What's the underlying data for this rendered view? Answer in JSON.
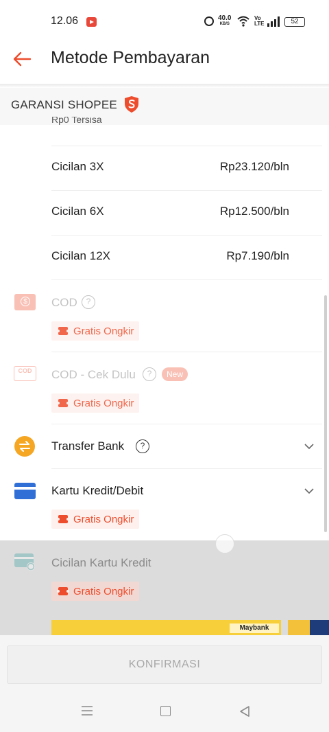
{
  "status_bar": {
    "time": "12.06",
    "net_speed": "40.0",
    "net_unit": "KB/S",
    "volte": "Vo LTE",
    "battery": "52"
  },
  "header": {
    "title": "Metode Pembayaran"
  },
  "garansi": {
    "label": "GARANSI SHOPEE"
  },
  "cicilan_partial": "Rp0 Tersisa",
  "cicilan_options": [
    {
      "label": "Cicilan 3X",
      "price": "Rp23.120/bln"
    },
    {
      "label": "Cicilan 6X",
      "price": "Rp12.500/bln"
    },
    {
      "label": "Cicilan 12X",
      "price": "Rp7.190/bln"
    }
  ],
  "methods": {
    "cod": {
      "label": "COD",
      "badge": "Gratis Ongkir"
    },
    "cod_cek": {
      "label": "COD - Cek Dulu",
      "new_badge": "New",
      "badge": "Gratis Ongkir",
      "icon_text": "COD"
    },
    "transfer": {
      "label": "Transfer Bank"
    },
    "kartu": {
      "label": "Kartu Kredit/Debit",
      "badge": "Gratis Ongkir"
    },
    "cicilan_kartu": {
      "label": "Cicilan Kartu Kredit",
      "badge": "Gratis Ongkir"
    }
  },
  "banner": {
    "text": "Maybank"
  },
  "confirm": {
    "label": "KONFIRMASI"
  },
  "colors": {
    "brand": "#ee4d2d",
    "transfer_icon": "#f5a623",
    "card_icon": "#2f6fd6"
  }
}
